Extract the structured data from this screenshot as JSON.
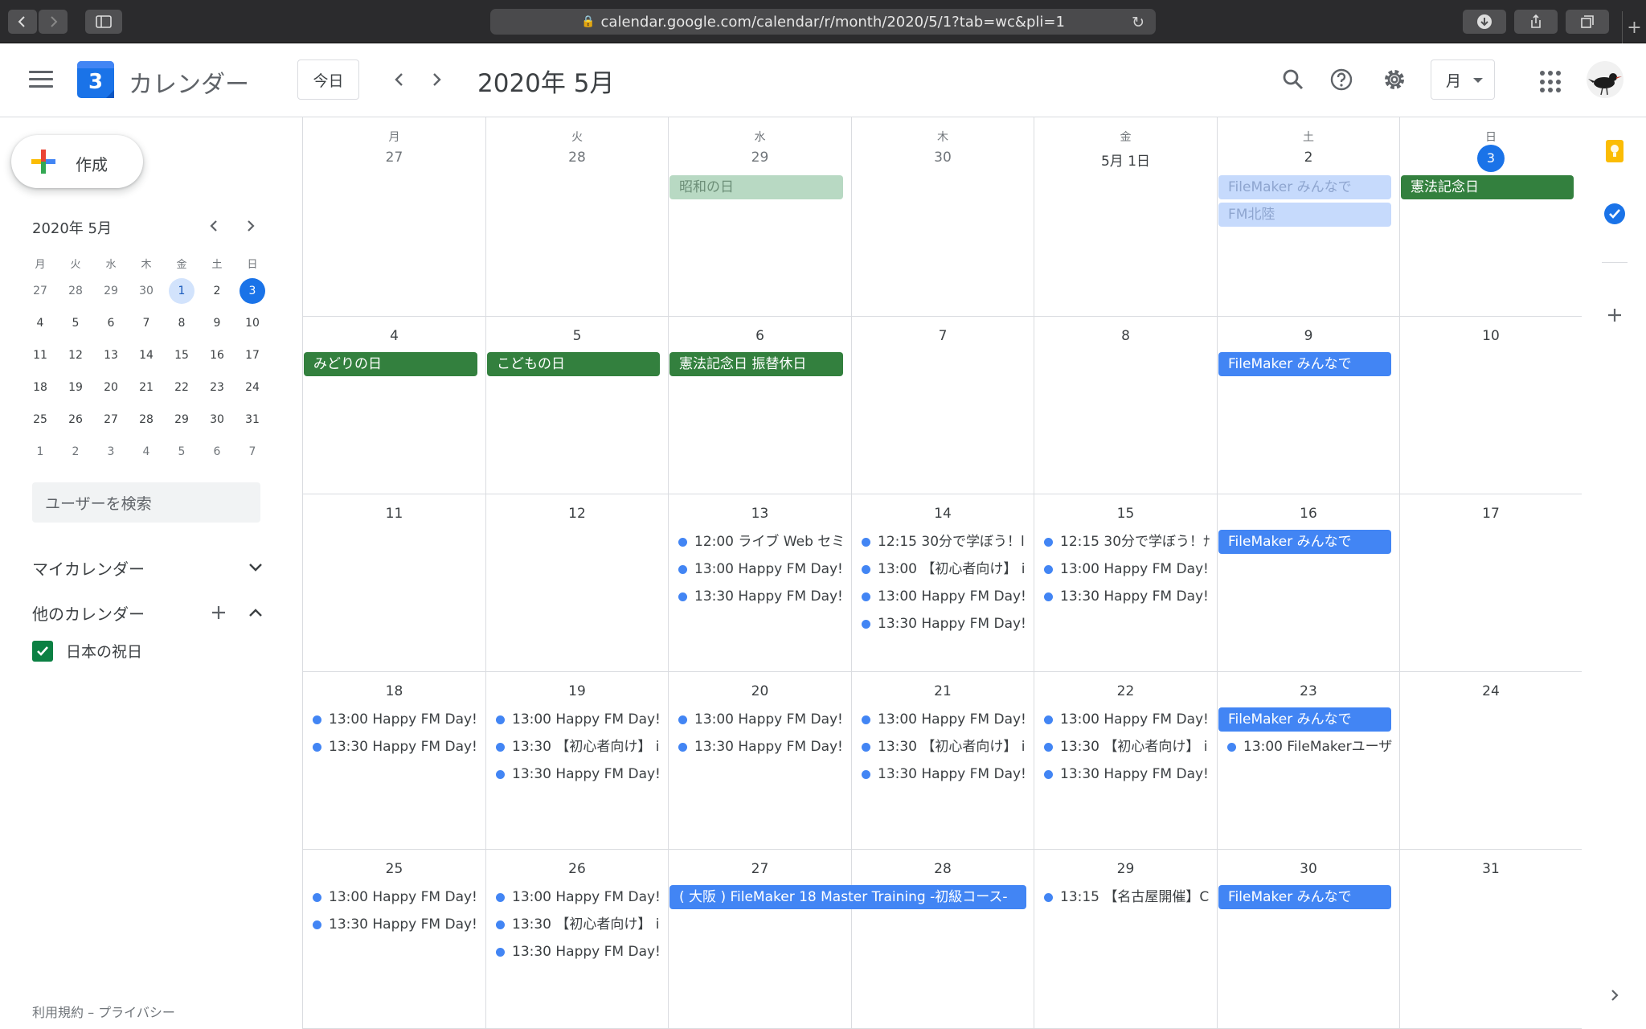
{
  "browser": {
    "url": "calendar.google.com/calendar/r/month/2020/5/1?tab=wc&pli=1"
  },
  "header": {
    "logo_day": "3",
    "app_title": "カレンダー",
    "today_label": "今日",
    "month_title": "2020年 5月",
    "view_label": "月"
  },
  "sidebar": {
    "create_label": "作成",
    "mini_title": "2020年 5月",
    "mini_weekdays": [
      "月",
      "火",
      "水",
      "木",
      "金",
      "土",
      "日"
    ],
    "mini_weeks": [
      [
        "27",
        "28",
        "29",
        "30",
        "1",
        "2",
        "3"
      ],
      [
        "4",
        "5",
        "6",
        "7",
        "8",
        "9",
        "10"
      ],
      [
        "11",
        "12",
        "13",
        "14",
        "15",
        "16",
        "17"
      ],
      [
        "18",
        "19",
        "20",
        "21",
        "22",
        "23",
        "24"
      ],
      [
        "25",
        "26",
        "27",
        "28",
        "29",
        "30",
        "31"
      ],
      [
        "1",
        "2",
        "3",
        "4",
        "5",
        "6",
        "7"
      ]
    ],
    "search_placeholder": "ユーザーを検索",
    "my_calendars": "マイカレンダー",
    "other_calendars": "他のカレンダー",
    "calendar_item": "日本の祝日",
    "footer": "利用規約 – プライバシー"
  },
  "calendar": {
    "weekdays": [
      "月",
      "火",
      "水",
      "木",
      "金",
      "土",
      "日"
    ],
    "weeks": [
      [
        "27",
        "28",
        "29",
        "30",
        "5月 1日",
        "2",
        "3"
      ],
      [
        "4",
        "5",
        "6",
        "7",
        "8",
        "9",
        "10"
      ],
      [
        "11",
        "12",
        "13",
        "14",
        "15",
        "16",
        "17"
      ],
      [
        "18",
        "19",
        "20",
        "21",
        "22",
        "23",
        "24"
      ],
      [
        "25",
        "26",
        "27",
        "28",
        "29",
        "30",
        "31"
      ]
    ],
    "events": {
      "w0": {
        "d2_chip": "昭和の日",
        "d5_chip1": "FileMaker みんなで",
        "d5_chip2": "FM北陸",
        "d6_chip": "憲法記念日"
      },
      "w1": {
        "d0_chip": "みどりの日",
        "d1_chip": "こどもの日",
        "d2_chip": "憲法記念日 振替休日",
        "d5_chip": "FileMaker みんなで"
      },
      "w2": {
        "d2": [
          "12:00 ライブ Web セミ",
          "13:00 Happy FM Day!",
          "13:30 Happy FM Day!"
        ],
        "d3": [
          "12:15 30分で学ぼう！l",
          "13:00 【初心者向け】 i",
          "13:00 Happy FM Day!",
          "13:30 Happy FM Day!"
        ],
        "d4": [
          "12:15 30分で学ぼう！ﾅ",
          "13:00 Happy FM Day!",
          "13:30 Happy FM Day!"
        ],
        "d5_chip": "FileMaker みんなで"
      },
      "w3": {
        "d0": [
          "13:00 Happy FM Day!",
          "13:30 Happy FM Day!"
        ],
        "d1": [
          "13:00 Happy FM Day!",
          "13:30 【初心者向け】 i",
          "13:30 Happy FM Day!"
        ],
        "d2": [
          "13:00 Happy FM Day!",
          "13:30 Happy FM Day!"
        ],
        "d3": [
          "13:00 Happy FM Day!",
          "13:30 【初心者向け】 i",
          "13:30 Happy FM Day!"
        ],
        "d4": [
          "13:00 Happy FM Day!",
          "13:30 【初心者向け】 i",
          "13:30 Happy FM Day!"
        ],
        "d5_chip": "FileMaker みんなで",
        "d5": [
          "13:00 FileMakerユーザ"
        ]
      },
      "w4": {
        "d0": [
          "13:00 Happy FM Day!",
          "13:30 Happy FM Day!"
        ],
        "d1": [
          "13:00 Happy FM Day!",
          "13:30 【初心者向け】 i",
          "13:30 Happy FM Day!"
        ],
        "d23_chip": "( 大阪 ) FileMaker 18 Master Training -初級コース-",
        "d4": [
          "13:15 【名古屋開催】C"
        ],
        "d5_chip": "FileMaker みんなで"
      }
    }
  },
  "colors": {
    "accent": "#1a73e8",
    "event_blue": "#4285f4",
    "holiday_green": "#33803e"
  }
}
